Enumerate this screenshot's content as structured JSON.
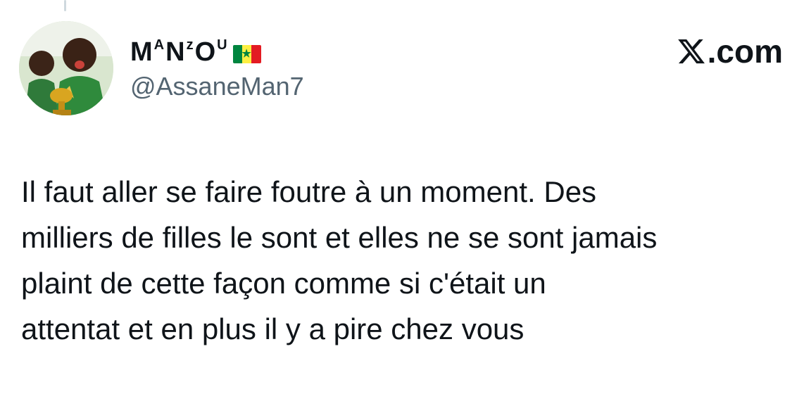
{
  "tweet": {
    "author": {
      "name_parts": [
        {
          "text": "M",
          "sup": false
        },
        {
          "text": "A",
          "sup": true
        },
        {
          "text": "N",
          "sup": false
        },
        {
          "text": "z",
          "sup": true
        },
        {
          "text": "O",
          "sup": false
        },
        {
          "text": "U",
          "sup": true
        }
      ],
      "flag_icon": "senegal-flag-icon",
      "handle": "@AssaneMan7"
    },
    "brand": {
      "logo_icon": "x-logo-icon",
      "suffix": ".com"
    },
    "text_lines": [
      "Il faut aller se faire foutre à un moment. Des",
      "milliers de filles le sont et elles ne se sont jamais",
      "plaint de cette façon comme si c'était un",
      "attentat et en plus il y a pire chez vous"
    ]
  },
  "colors": {
    "text": "#0f1419",
    "secondary": "#536471",
    "flag_green": "#00853f",
    "flag_yellow": "#fdef42",
    "flag_red": "#e31b23"
  }
}
